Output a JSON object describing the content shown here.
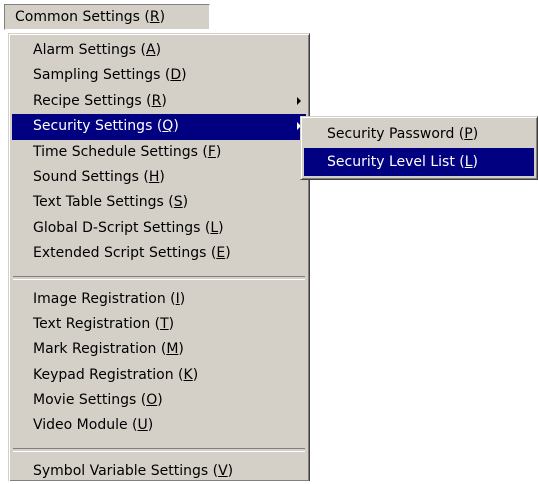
{
  "menubar": {
    "label": "Common Settings (",
    "key": "R",
    "close": ")"
  },
  "main_menu": {
    "group1": [
      {
        "label": "Alarm Settings (",
        "key": "A",
        "close": ")"
      },
      {
        "label": "Sampling Settings (",
        "key": "D",
        "close": ")"
      },
      {
        "label": "Recipe Settings (",
        "key": "R",
        "close": ")"
      },
      {
        "label": "Security Settings (",
        "key": "Q",
        "close": ")"
      },
      {
        "label": "Time Schedule Settings (",
        "key": "F",
        "close": ")"
      },
      {
        "label": "Sound Settings (",
        "key": "H",
        "close": ")"
      },
      {
        "label": "Text Table Settings (",
        "key": "S",
        "close": ")"
      },
      {
        "label": "Global D-Script Settings (",
        "key": "L",
        "close": ")"
      },
      {
        "label": "Extended Script Settings (",
        "key": "E",
        "close": ")"
      }
    ],
    "group2": [
      {
        "label": "Image Registration (",
        "key": "I",
        "close": ")"
      },
      {
        "label": "Text Registration (",
        "key": "T",
        "close": ")"
      },
      {
        "label": "Mark Registration (",
        "key": "M",
        "close": ")"
      },
      {
        "label": "Keypad Registration (",
        "key": "K",
        "close": ")"
      },
      {
        "label": "Movie Settings (",
        "key": "O",
        "close": ")"
      },
      {
        "label": "Video Module (",
        "key": "U",
        "close": ")"
      }
    ],
    "group3": [
      {
        "label": "Symbol Variable Settings (",
        "key": "V",
        "close": ")"
      }
    ]
  },
  "sub_menu": [
    {
      "label": "Security Password (",
      "key": "P",
      "close": ")"
    },
    {
      "label": "Security Level List (",
      "key": "L",
      "close": ")"
    }
  ],
  "colors": {
    "menu_bg": "#d4d0c8",
    "highlight": "#000080",
    "highlight_text": "#ffffff"
  },
  "icons": {
    "submenu_arrow": "right-triangle"
  }
}
